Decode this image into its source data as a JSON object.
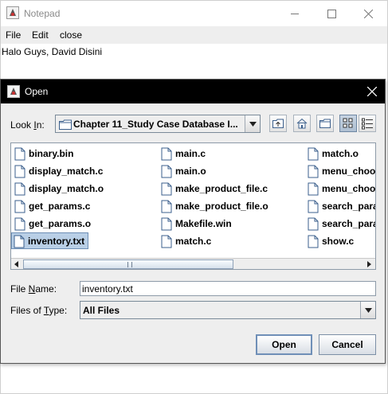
{
  "notepad": {
    "title": "Notepad",
    "menu": [
      "File",
      "Edit",
      "close"
    ],
    "content": "Halo Guys, David Disini",
    "window_controls": [
      "minimize-icon",
      "maximize-icon",
      "close-icon"
    ]
  },
  "dialog": {
    "title": "Open",
    "look_in": {
      "label_pre": "Look ",
      "label_mnemonic": "I",
      "label_post": "n:",
      "value": "Chapter 11_Study Case Database I..."
    },
    "toolbar_icons": [
      "up-one-level-icon",
      "home-icon",
      "new-folder-icon",
      "list-view-icon",
      "details-view-icon"
    ],
    "files": [
      [
        "binary.bin",
        "display_match.c",
        "display_match.o",
        "get_params.c",
        "get_params.o",
        "inventory.txt"
      ],
      [
        "main.c",
        "main.o",
        "make_product_file.c",
        "make_product_file.o",
        "Makefile.win",
        "match.c"
      ],
      [
        "match.o",
        "menu_choo",
        "menu_choo",
        "search_para",
        "search_para",
        "show.c"
      ]
    ],
    "selected_file": "inventory.txt",
    "file_name": {
      "label_pre": "File ",
      "label_mnemonic": "N",
      "label_post": "ame:",
      "value": "inventory.txt"
    },
    "files_of_type": {
      "label_pre": "Files of ",
      "label_mnemonic": "T",
      "label_post": "ype:",
      "value": "All Files"
    },
    "buttons": {
      "open": "Open",
      "cancel": "Cancel"
    }
  },
  "colors": {
    "dialog_title_bg": "#000000",
    "panel_bg": "#eeeeee",
    "selection_bg": "#b9cfe6",
    "file_icon_stroke": "#3b5f8c"
  }
}
